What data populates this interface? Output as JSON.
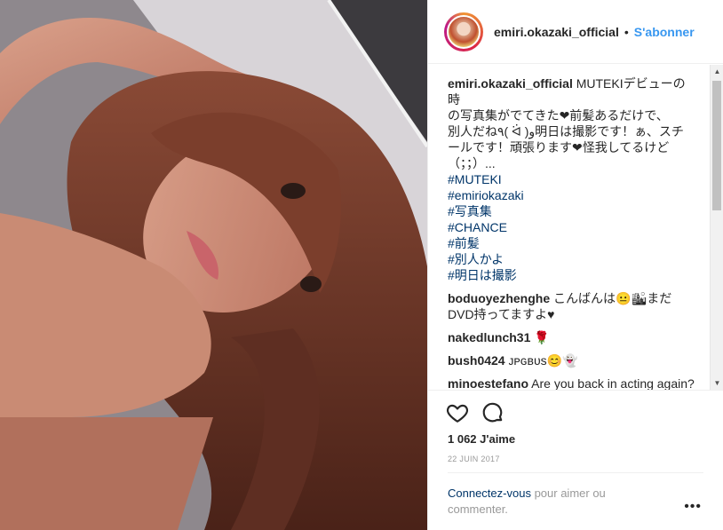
{
  "post": {
    "username": "emiri.okazaki_official",
    "separator": "•",
    "follow_label": "S'abonner",
    "caption_lines": [
      "MUTEKIデビューの時",
      "の写真集がでてきた❤前髪あるだけで、",
      "別人だね٩( ᐛ )و明日は撮影です！ぁ、スチ",
      "ールです！頑張ります❤怪我してるけど",
      "（；；）..."
    ],
    "hashtags": [
      "#MUTEKI",
      "#emiriokazaki",
      "#写真集",
      "#CHANCE",
      "#前髪",
      "#別人かよ",
      "#明日は撮影"
    ]
  },
  "comments": [
    {
      "user": "boduoyezhenghe",
      "text": "こんばんは😐🏙まだDVD持ってますよ♥"
    },
    {
      "user": "nakedlunch31",
      "text": "🌹"
    },
    {
      "user": "bush0424",
      "text": "ᴊᴘɢʙᴜs😊👻"
    },
    {
      "user": "minoestefano",
      "text": "Are you back in acting again?"
    }
  ],
  "actions": {
    "like_icon": "heart-icon",
    "comment_icon": "speech-bubble-icon",
    "likes_text": "1 062 J'aime",
    "date_text": "22 JUIN 2017",
    "login_link": "Connectez-vous",
    "login_rest": " pour aimer ou commenter.",
    "more_label": "•••"
  },
  "scrollbar": {
    "up_icon": "▲",
    "down_icon": "▼"
  }
}
